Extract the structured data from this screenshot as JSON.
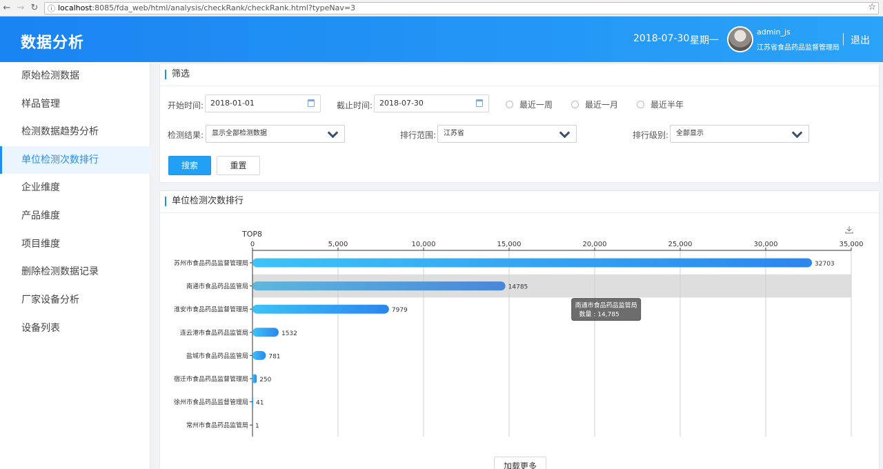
{
  "browser": {
    "url_host": "localhost",
    "url_path": ":8085/fda_web/html/analysis/checkRank/checkRank.html?typeNav=3"
  },
  "header": {
    "title": "数据分析",
    "date": "2018-07-30",
    "weekday": "星期一",
    "user_name": "admin_js",
    "user_org": "江苏省食品药品监督管理局",
    "logout": "退出"
  },
  "sidebar": {
    "items": [
      {
        "label": "原始检测数据",
        "active": false
      },
      {
        "label": "样品管理",
        "active": false
      },
      {
        "label": "检测数据趋势分析",
        "active": false
      },
      {
        "label": "单位检测次数排行",
        "active": true
      },
      {
        "label": "企业维度",
        "active": false
      },
      {
        "label": "产品维度",
        "active": false
      },
      {
        "label": "项目维度",
        "active": false
      },
      {
        "label": "删除检测数据记录",
        "active": false
      },
      {
        "label": "厂家设备分析",
        "active": false
      },
      {
        "label": "设备列表",
        "active": false
      }
    ]
  },
  "filter": {
    "title": "筛选",
    "start_label": "开始时间:",
    "start_value": "2018-01-01",
    "end_label": "截止时间:",
    "end_value": "2018-07-30",
    "radios": [
      "最近一周",
      "最近一月",
      "最近半年"
    ],
    "result_label": "检测结果:",
    "result_value": "显示全部检测数据",
    "range_label": "排行范围:",
    "range_value": "江苏省",
    "level_label": "排行级别:",
    "level_value": "全部显示",
    "search_btn": "搜索",
    "reset_btn": "重置"
  },
  "ranking": {
    "title": "单位检测次数排行",
    "load_more": "加载更多"
  },
  "chart_data": {
    "type": "bar",
    "orientation": "horizontal",
    "title": "TOP8",
    "categories": [
      "苏州市食品药品监督管理局",
      "南通市食品药品监管局",
      "淮安市食品药品监督管理局",
      "连云港市食品药品监管局",
      "盐城市食品药品监管局",
      "宿迁市食品药品监督管理局",
      "徐州市食品药品监督管理局",
      "常州市食品药品监管局"
    ],
    "values": [
      32703,
      14785,
      7979,
      1532,
      781,
      250,
      41,
      1
    ],
    "xlim": [
      0,
      35000
    ],
    "ticks": [
      "0",
      "5,000",
      "10,000",
      "15,000",
      "20,000",
      "25,000",
      "30,000",
      "35,000"
    ],
    "grid": true,
    "highlighted_index": 1,
    "tooltip": {
      "name": "南通市食品药品监管局",
      "text": "数量 : 14,785"
    }
  }
}
